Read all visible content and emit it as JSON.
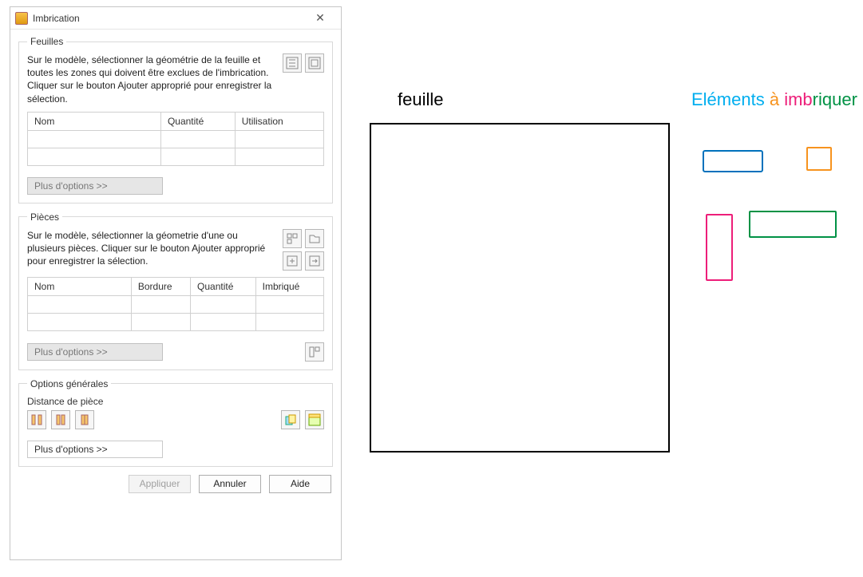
{
  "window": {
    "title": "Imbrication"
  },
  "feuilles": {
    "legend": "Feuilles",
    "instructions": "Sur le modèle, sélectionner la géométrie de la feuille et toutes les zones qui doivent être exclues de l'imbrication. Cliquer sur le bouton Ajouter approprié pour enregistrer la sélection.",
    "columns": {
      "c0": "Nom",
      "c1": "Quantité",
      "c2": "Utilisation"
    },
    "more": "Plus d'options >>"
  },
  "pieces": {
    "legend": "Pièces",
    "instructions": "Sur le modèle, sélectionner la géometrie d'une ou plusieurs pièces. Cliquer sur le bouton Ajouter approprié pour enregistrer la sélection.",
    "columns": {
      "c0": "Nom",
      "c1": "Bordure",
      "c2": "Quantité",
      "c3": "Imbriqué"
    },
    "more": "Plus d'options >>"
  },
  "general": {
    "legend": "Options générales",
    "distance_label": "Distance de pièce",
    "more": "Plus d'options >>"
  },
  "footer": {
    "apply": "Appliquer",
    "cancel": "Annuler",
    "help": "Aide"
  },
  "illus": {
    "feuille": "feuille",
    "elements": {
      "w1": "Eléments",
      "w2": "à",
      "w3": "imb",
      "w4": "riquer"
    }
  }
}
